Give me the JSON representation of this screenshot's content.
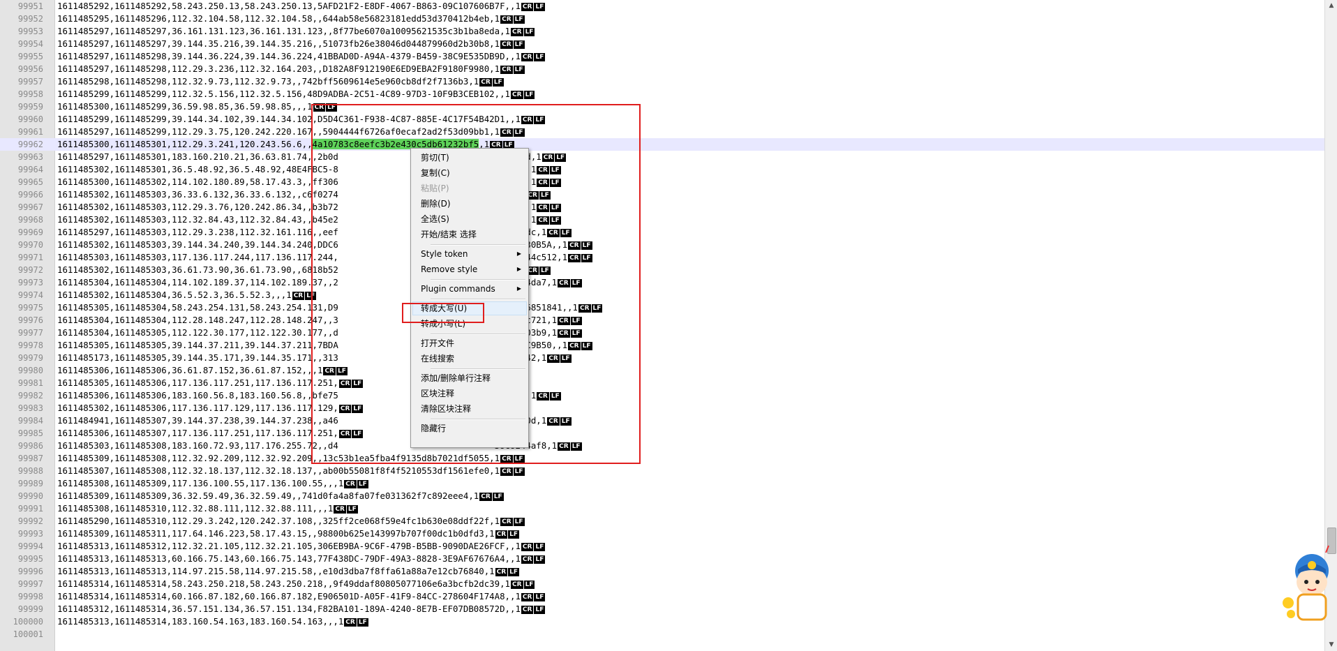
{
  "editor": {
    "lines": [
      {
        "num": "99951",
        "text": "1611485292,1611485292,58.243.250.13,58.243.250.13,5AFD21F2-E8DF-4067-B863-09C107606B7F,,1"
      },
      {
        "num": "99952",
        "text": "1611485295,1611485296,112.32.104.58,112.32.104.58,,644ab58e56823181edd53d370412b4eb,1"
      },
      {
        "num": "99953",
        "text": "1611485297,1611485297,36.161.131.123,36.161.131.123,,8f77be6070a10095621535c3b1ba8eda,1"
      },
      {
        "num": "99954",
        "text": "1611485297,1611485297,39.144.35.216,39.144.35.216,,51073fb26e38046d044879960d2b30b8,1"
      },
      {
        "num": "99955",
        "text": "1611485297,1611485298,39.144.36.224,39.144.36.224,41BBAD0D-A94A-4379-B459-38C9E535DB9D,,1"
      },
      {
        "num": "99956",
        "text": "1611485297,1611485298,112.29.3.236,112.32.164.203,,D182A8F912190E6ED9EBA2F9180F9980,1"
      },
      {
        "num": "99957",
        "text": "1611485298,1611485298,112.32.9.73,112.32.9.73,,742bff5609614e5e960cb8df2f7136b3,1"
      },
      {
        "num": "99958",
        "text": "1611485299,1611485299,112.32.5.156,112.32.5.156,48D9ADBA-2C51-4C89-97D3-10F9B3CEB102,,1"
      },
      {
        "num": "99959",
        "text": "1611485300,1611485299,36.59.98.85,36.59.98.85,,,1"
      },
      {
        "num": "99960",
        "text": "1611485299,1611485299,39.144.34.102,39.144.34.102,D5D4C361-F938-4C87-885E-4C17F54B42D1,,1"
      },
      {
        "num": "99961",
        "text": "1611485297,1611485299,112.29.3.75,120.242.220.167,,5904444f6726af0ecaf2ad2f53d09bb1,1"
      },
      {
        "num": "99962",
        "text": "1611485300,1611485301,112.29.3.241,120.243.56.6,,",
        "sel": "4a10783c8eefc3b2e430c5db61232bf5",
        "after": ",1"
      },
      {
        "num": "99963",
        "text": "1611485297,1611485301,183.160.210.21,36.63.81.74,,2b0d                              8b22e8d,1"
      },
      {
        "num": "99964",
        "text": "1611485302,1611485301,36.5.48.92,36.5.48.92,48E4FBC5-8                              778DA,,1"
      },
      {
        "num": "99965",
        "text": "1611485300,1611485302,114.102.180.89,58.17.43.3,,ff306                              6d37f7,1"
      },
      {
        "num": "99966",
        "text": "1611485302,1611485303,36.33.6.132,36.33.6.132,,c6f0274                              823a,1"
      },
      {
        "num": "99967",
        "text": "1611485302,1611485303,112.29.3.76,120.242.86.34,,b3b72                              281e17,1"
      },
      {
        "num": "99968",
        "text": "1611485302,1611485303,112.32.84.43,112.32.84.43,,b45e2                              7c4748,1"
      },
      {
        "num": "99969",
        "text": "1611485297,1611485303,112.29.3.238,112.32.161.116,,eef                              ee02dddc,1"
      },
      {
        "num": "99970",
        "text": "1611485302,1611485303,39.144.34.240,39.144.34.240,DDC6                              E5CEBD30B5A,,1"
      },
      {
        "num": "99971",
        "text": "1611485303,1611485303,117.136.117.244,117.136.117.244,                              c1f1d244c512,1"
      },
      {
        "num": "99972",
        "text": "1611485302,1611485303,36.61.73.90,36.61.73.90,,6818b52                              4e28,1"
      },
      {
        "num": "99973",
        "text": "1611485304,1611485304,114.102.189.37,114.102.189.37,,2                              51edf84da7,1"
      },
      {
        "num": "99974",
        "text": "1611485302,1611485304,36.5.52.3,36.5.52.3,,,1"
      },
      {
        "num": "99975",
        "text": "1611485305,1611485304,58.243.254.131,58.243.254.131,D9                              -FF0516851841,,1"
      },
      {
        "num": "99976",
        "text": "1611485304,1611485304,112.28.148.247,112.28.148.247,,3                              e26a4bc721,1"
      },
      {
        "num": "99977",
        "text": "1611485304,1611485305,112.122.30.177,112.122.30.177,,d                              5343b903b9,1"
      },
      {
        "num": "99978",
        "text": "1611485305,1611485305,39.144.37.211,39.144.37.211,7BDA                              91B4FFC9B50,,1"
      },
      {
        "num": "99979",
        "text": "1611485173,1611485305,39.144.35.171,39.144.35.171,,313                              c7d2c742,1"
      },
      {
        "num": "99980",
        "text": "1611485306,1611485306,36.61.87.152,36.61.87.152,,,1"
      },
      {
        "num": "99981",
        "text": "1611485305,1611485306,117.136.117.251,117.136.117.251,"
      },
      {
        "num": "99982",
        "text": "1611485306,1611485306,183.160.56.8,183.160.56.8,,bfe75                              ffe69a,1"
      },
      {
        "num": "99983",
        "text": "1611485302,1611485306,117.136.117.129,117.136.117.129,"
      },
      {
        "num": "99984",
        "text": "1611484941,1611485307,39.144.37.238,39.144.37.238,,a46                              49da8c0d,1"
      },
      {
        "num": "99985",
        "text": "1611485306,1611485307,117.136.117.251,117.136.117.251,"
      },
      {
        "num": "99986",
        "text": "1611485303,1611485308,183.160.72.93,117.176.255.72,,d4                              38c8244af8,1"
      },
      {
        "num": "99987",
        "text": "1611485309,1611485308,112.32.92.209,112.32.92.209,,13c53b1ea5fba4f9135d8b7021df5055,1"
      },
      {
        "num": "99988",
        "text": "1611485307,1611485308,112.32.18.137,112.32.18.137,,ab00b55081f8f4f5210553df1561efe0,1"
      },
      {
        "num": "99989",
        "text": "1611485308,1611485309,117.136.100.55,117.136.100.55,,,1"
      },
      {
        "num": "99990",
        "text": "1611485309,1611485309,36.32.59.49,36.32.59.49,,741d0fa4a8fa07fe031362f7c892eee4,1"
      },
      {
        "num": "99991",
        "text": "1611485308,1611485310,112.32.88.111,112.32.88.111,,,1"
      },
      {
        "num": "99992",
        "text": "1611485290,1611485310,112.29.3.242,120.242.37.108,,325ff2ce068f59e4fc1b630e08ddf22f,1"
      },
      {
        "num": "99993",
        "text": "1611485309,1611485311,117.64.146.223,58.17.43.15,,98800b625e143997b707f00dc1b0dfd3,1"
      },
      {
        "num": "99994",
        "text": "1611485313,1611485312,112.32.21.105,112.32.21.105,306EB9BA-9C6F-479B-B5BB-9090DAE26FCF,,1"
      },
      {
        "num": "99995",
        "text": "1611485313,1611485313,60.166.75.143,60.166.75.143,77F438DC-79DF-49A3-8828-3E9AF67676A4,,1"
      },
      {
        "num": "99996",
        "text": "1611485313,1611485313,114.97.215.58,114.97.215.58,,e10d3dba7f8ffa61a88a7e12cb76840,1"
      },
      {
        "num": "99997",
        "text": "1611485314,1611485314,58.243.250.218,58.243.250.218,,9f49ddaf80805077106e6a3bcfb2dc39,1"
      },
      {
        "num": "99998",
        "text": "1611485314,1611485314,60.166.87.182,60.166.87.182,E906501D-A05F-41F9-84CC-278604F174A8,,1"
      },
      {
        "num": "99999",
        "text": "1611485312,1611485314,36.57.151.134,36.57.151.134,F82BA101-189A-4240-8E7B-EF07DB08572D,,1"
      },
      {
        "num": "100000",
        "text": "1611485313,1611485314,183.160.54.163,183.160.54.163,,,1"
      },
      {
        "num": "100001",
        "text": "",
        "noEol": true
      }
    ],
    "eol_marker": [
      "CR",
      "LF"
    ]
  },
  "context_menu": {
    "items": [
      {
        "label": "剪切(T)",
        "name": "menu-item-cut"
      },
      {
        "label": "复制(C)",
        "name": "menu-item-copy"
      },
      {
        "label": "粘贴(P)",
        "name": "menu-item-paste",
        "disabled": true
      },
      {
        "label": "删除(D)",
        "name": "menu-item-delete"
      },
      {
        "label": "全选(S)",
        "name": "menu-item-select-all"
      },
      {
        "label": "开始/结束 选择",
        "name": "menu-item-begin-end-select"
      },
      {
        "sep": true
      },
      {
        "label": "Style token",
        "name": "menu-item-style-token",
        "submenu": true
      },
      {
        "label": "Remove style",
        "name": "menu-item-remove-style",
        "submenu": true
      },
      {
        "sep": true
      },
      {
        "label": "Plugin commands",
        "name": "menu-item-plugin-commands",
        "submenu": true
      },
      {
        "sep": true
      },
      {
        "label": "转成大写(U)",
        "name": "menu-item-uppercase",
        "hover": true
      },
      {
        "label": "转成小写(L)",
        "name": "menu-item-lowercase"
      },
      {
        "sep": true
      },
      {
        "label": "打开文件",
        "name": "menu-item-open-file"
      },
      {
        "label": "在线搜索",
        "name": "menu-item-search-online"
      },
      {
        "sep": true
      },
      {
        "label": "添加/删除单行注释",
        "name": "menu-item-toggle-line-comment"
      },
      {
        "label": "区块注释",
        "name": "menu-item-block-comment"
      },
      {
        "label": "清除区块注释",
        "name": "menu-item-clear-block-comment"
      },
      {
        "sep": true
      },
      {
        "label": "隐藏行",
        "name": "menu-item-hide-lines"
      }
    ],
    "submenu_arrow": "▶"
  },
  "colors": {
    "selection": "#5fd35a",
    "annotation": "#e01d1d",
    "menu_bg": "#f0f0f0"
  },
  "icons": {
    "scroll_up": "▲",
    "scroll_down": "▼"
  }
}
